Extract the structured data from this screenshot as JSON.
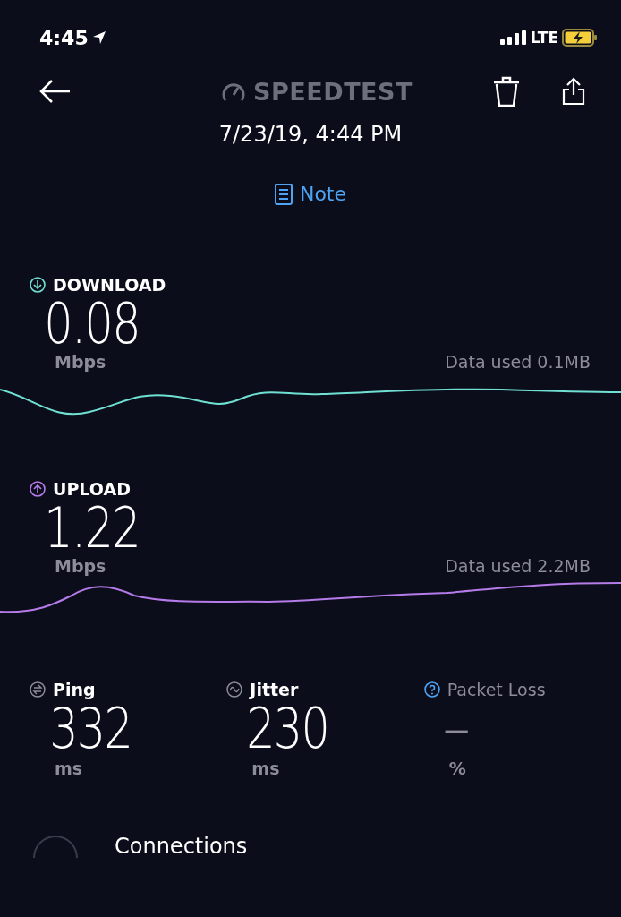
{
  "status_bar": {
    "time": "4:45",
    "network": "LTE",
    "charging": true
  },
  "header": {
    "title": "SPEEDTEST",
    "date": "7/23/19, 4:44 PM",
    "note": "Note"
  },
  "speeds": [
    {
      "kind": "download",
      "label": "DOWNLOAD",
      "value": "0.08",
      "unit": "Mbps",
      "data_used": "Data used 0.1MB",
      "color": "#6fe0d2"
    },
    {
      "kind": "upload",
      "label": "UPLOAD",
      "value": "1.22",
      "unit": "Mbps",
      "data_used": "Data used 2.2MB",
      "color": "#b57be8"
    }
  ],
  "stats": [
    {
      "kind": "ping",
      "label": "Ping",
      "value": "332",
      "unit": "ms",
      "muted": false
    },
    {
      "kind": "jitter",
      "label": "Jitter",
      "value": "230",
      "unit": "ms",
      "muted": false
    },
    {
      "kind": "help",
      "label": "Packet Loss",
      "value": "—",
      "unit": "%",
      "muted": true
    }
  ],
  "connections": {
    "label": "Connections"
  }
}
